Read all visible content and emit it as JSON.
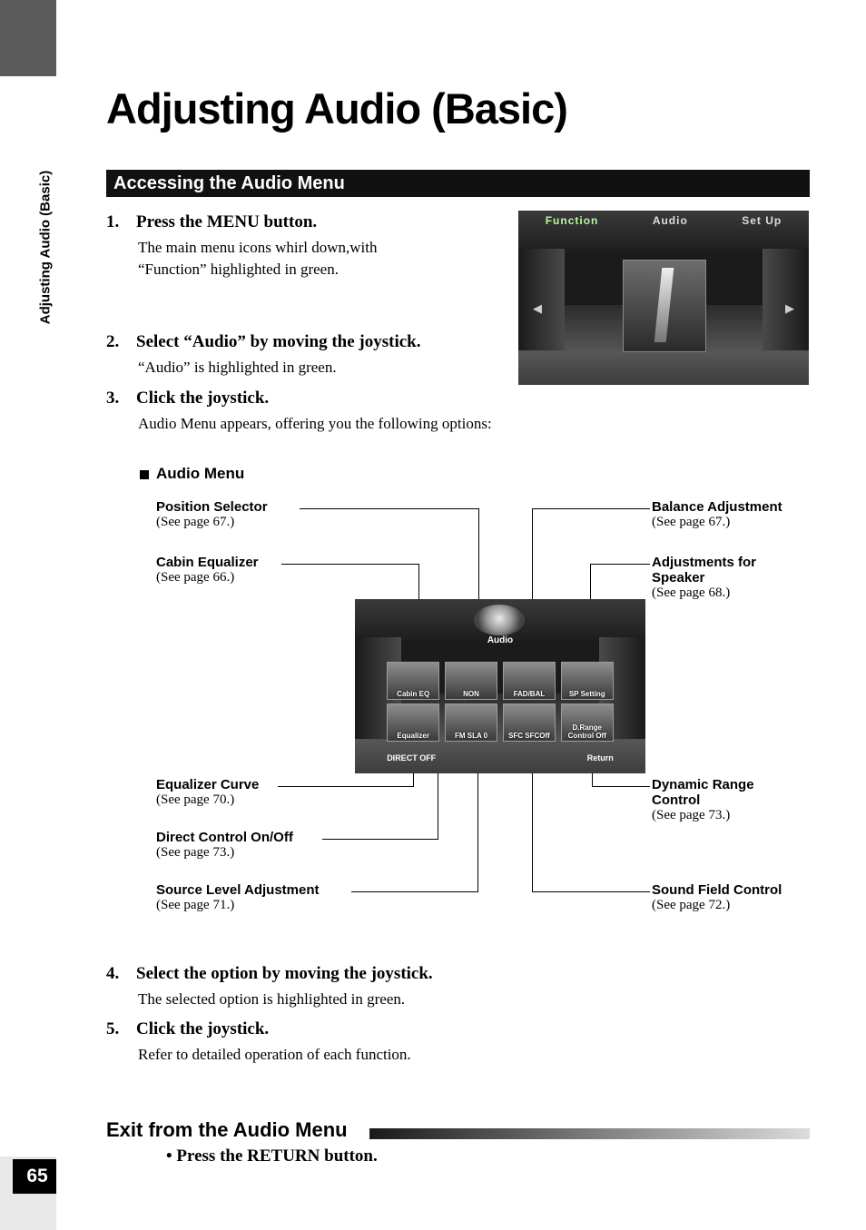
{
  "sidebar": {
    "running_head": "Adjusting Audio (Basic)",
    "page_number": "65"
  },
  "header": {
    "title": "Adjusting Audio (Basic)",
    "section_bar": "Accessing the Audio Menu"
  },
  "steps": [
    {
      "num": "1.",
      "head": "Press the MENU button.",
      "body_line1": "The main menu icons whirl down,with",
      "body_line2": "“Function” highlighted in green."
    },
    {
      "num": "2.",
      "head": "Select “Audio” by moving the joystick.",
      "body_line1": "“Audio” is highlighted in green.",
      "body_line2": ""
    },
    {
      "num": "3.",
      "head": "Click the joystick.",
      "body_line1": "Audio Menu appears, offering you the following options:",
      "body_line2": ""
    },
    {
      "num": "4.",
      "head": "Select the option by moving the joystick.",
      "body_line1": "The selected option is highlighted in green.",
      "body_line2": ""
    },
    {
      "num": "5.",
      "head": "Click the joystick.",
      "body_line1": "Refer to detailed operation of each function.",
      "body_line2": ""
    }
  ],
  "audio_menu_heading": "Audio Menu",
  "screen_main_menu": {
    "tabs": [
      "Function",
      "Audio",
      "Set Up"
    ],
    "highlighted_tab": "Audio",
    "arrow_left": "◀",
    "arrow_right": "▶"
  },
  "screen_audio_menu": {
    "title": "Audio",
    "row1": [
      "Cabin EQ",
      "NON",
      "FAD/BAL",
      "SP Setting"
    ],
    "row2": [
      "Equalizer",
      "FM\nSLA 0",
      "SFC\nSFCOff",
      "D.Range\nControl\nOff"
    ],
    "bottom_left": "DIRECT OFF",
    "bottom_right": "Return"
  },
  "callouts": {
    "left": [
      {
        "label": "Position Selector",
        "page": "(See page 67.)"
      },
      {
        "label": "Cabin Equalizer",
        "page": "(See page 66.)"
      },
      {
        "label": "Equalizer Curve",
        "page": "(See page 70.)"
      },
      {
        "label": "Direct Control On/Off",
        "page": "(See page 73.)"
      },
      {
        "label": "Source Level Adjustment",
        "page": "(See page 71.)"
      }
    ],
    "right": [
      {
        "label": "Balance Adjustment",
        "page": "(See page 67.)"
      },
      {
        "label": "Adjustments for",
        "label2": "Speaker",
        "page": "(See page 68.)"
      },
      {
        "label": "Dynamic Range",
        "label2": "Control",
        "page": "(See page 73.)"
      },
      {
        "label": "Sound Field Control",
        "page": "(See page 72.)"
      }
    ]
  },
  "exit": {
    "heading": "Exit from the Audio Menu",
    "bullet": "•  Press the RETURN button."
  }
}
